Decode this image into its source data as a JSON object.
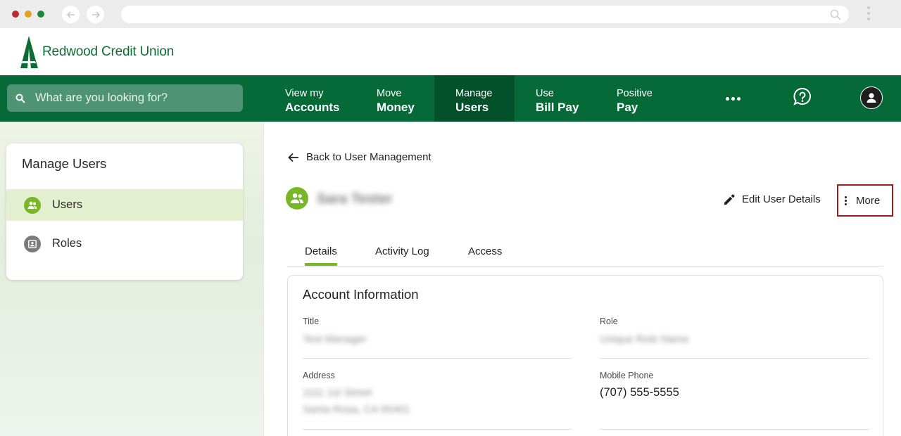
{
  "brand": {
    "name": "Redwood Credit Union",
    "primary_color": "#056a38",
    "accent_color": "#78b828"
  },
  "browser": {
    "url": ""
  },
  "nav": {
    "search_placeholder": "What are you looking for?",
    "items": [
      {
        "line1": "View my",
        "line2": "Accounts"
      },
      {
        "line1": "Move",
        "line2": "Money"
      },
      {
        "line1": "Manage",
        "line2": "Users"
      },
      {
        "line1": "Use",
        "line2": "Bill Pay"
      },
      {
        "line1": "Positive",
        "line2": "Pay"
      }
    ],
    "active_index": 2
  },
  "sidebar": {
    "title": "Manage Users",
    "items": [
      {
        "label": "Users",
        "icon": "users-icon",
        "selected": true
      },
      {
        "label": "Roles",
        "icon": "roles-icon",
        "selected": false
      }
    ]
  },
  "main": {
    "back_label": "Back to User Management",
    "user_name": "Sara Tester",
    "edit_label": "Edit User Details",
    "more_label": "More",
    "tabs": [
      {
        "label": "Details",
        "active": true
      },
      {
        "label": "Activity Log",
        "active": false
      },
      {
        "label": "Access",
        "active": false
      }
    ],
    "account_card": {
      "title": "Account Information",
      "fields": {
        "title_label": "Title",
        "title_value": "Test Manager",
        "role_label": "Role",
        "role_value": "Unique Role Name",
        "address_label": "Address",
        "address_line1": "1111 1st Street",
        "address_line2": "Santa Rosa, CA 95401",
        "phone_label": "Mobile Phone",
        "phone_value": "(707) 555-5555"
      }
    }
  }
}
